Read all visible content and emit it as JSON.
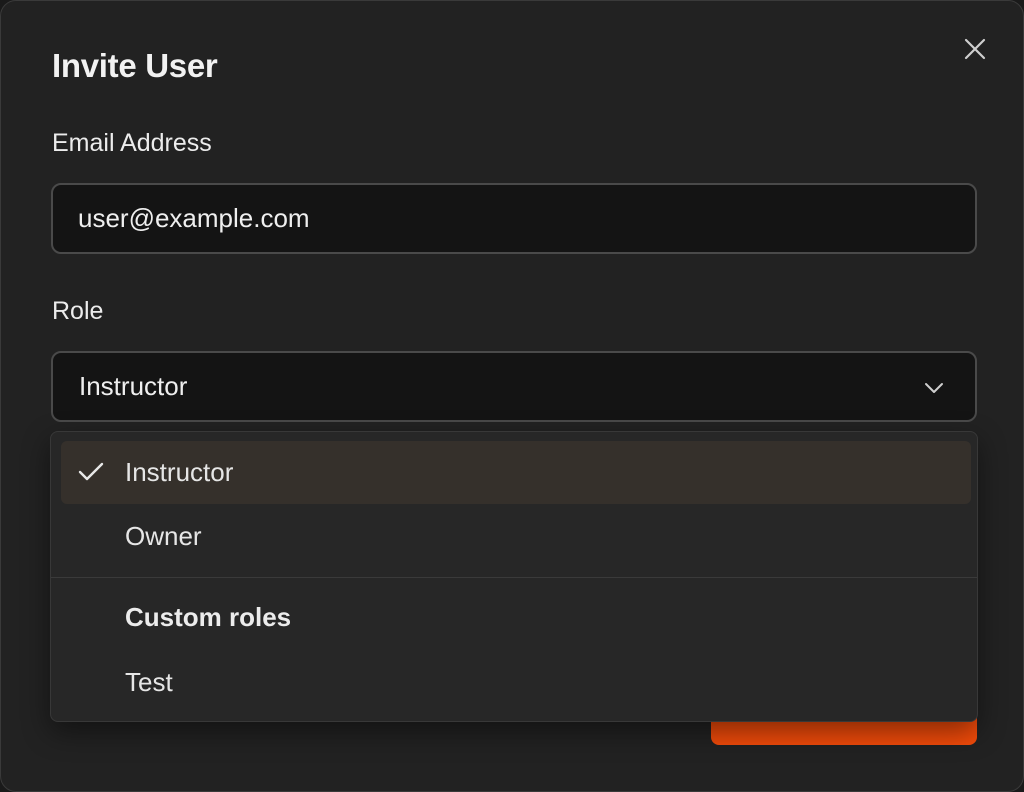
{
  "dialog": {
    "title": "Invite User",
    "email_label": "Email Address",
    "email_value": "user@example.com",
    "role_label": "Role",
    "role_selected": "Instructor"
  },
  "role_menu": {
    "items": [
      {
        "label": "Instructor",
        "selected": true
      },
      {
        "label": "Owner",
        "selected": false
      }
    ],
    "custom_group_label": "Custom roles",
    "custom_items": [
      {
        "label": "Test",
        "selected": false
      }
    ]
  },
  "icons": {
    "close": "close-icon",
    "chevron": "chevron-down-icon",
    "check": "check-icon"
  },
  "colors": {
    "accent": "#f24b0a",
    "dialog_bg": "#222222",
    "selected_item_bg": "#35302b"
  }
}
